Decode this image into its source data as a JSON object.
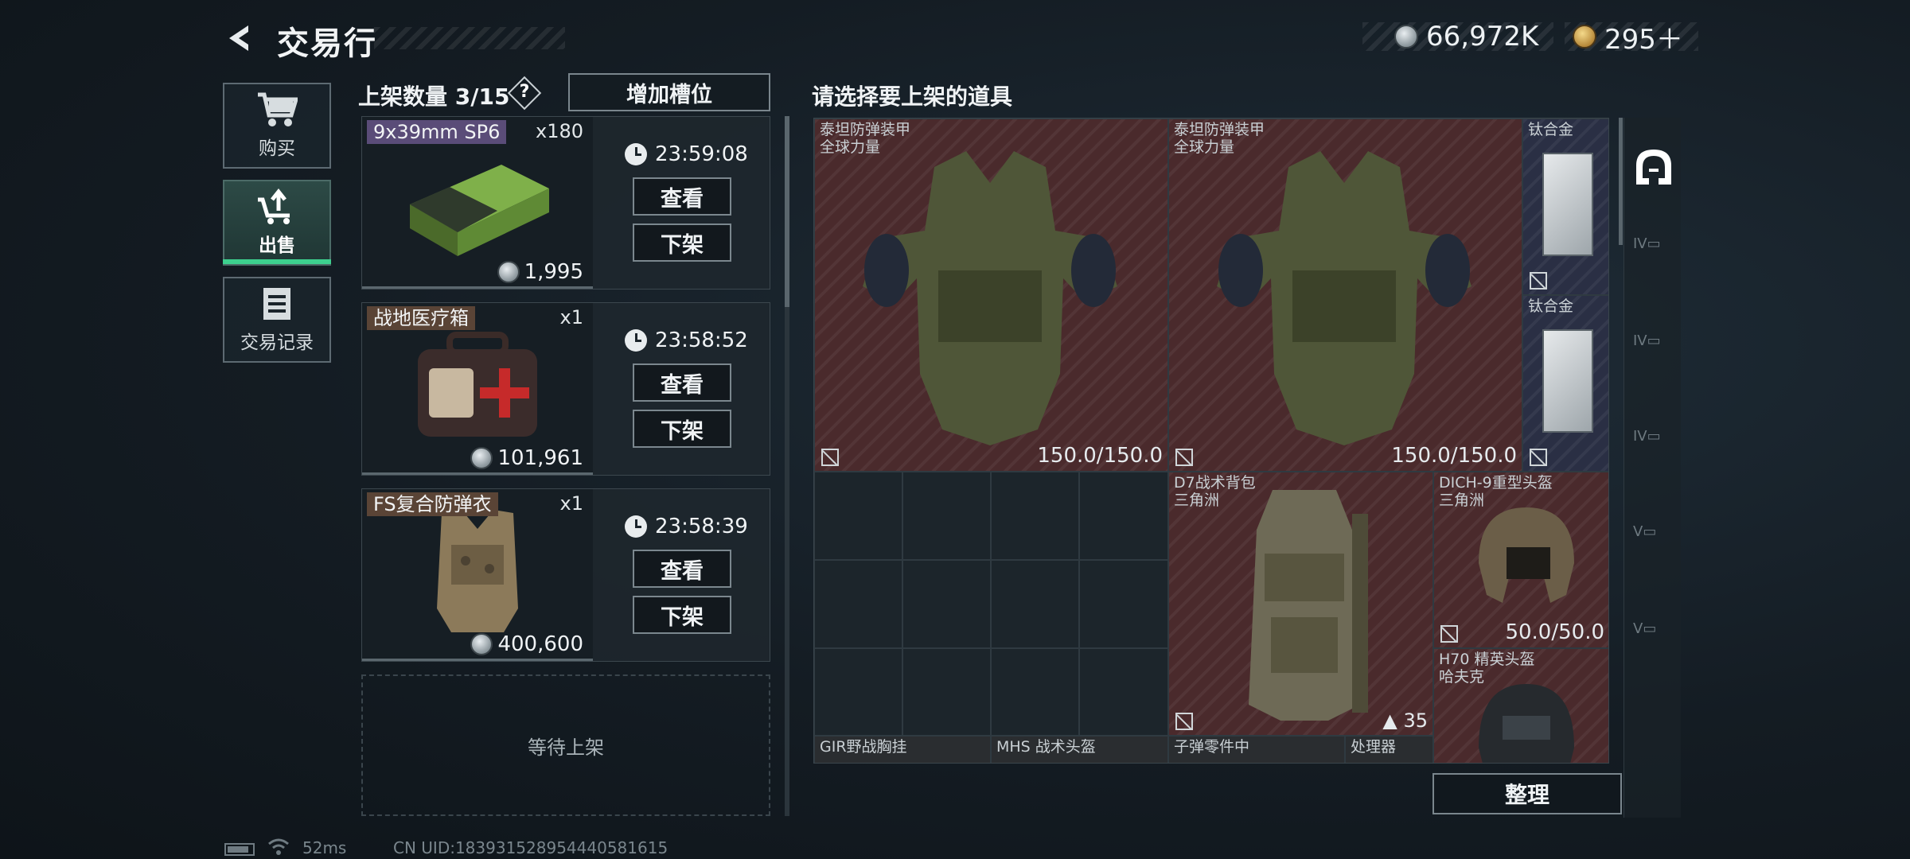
{
  "header": {
    "title": "交易行",
    "currency_silver": "66,972K",
    "currency_gold": "295＋"
  },
  "nav": {
    "buy": "购买",
    "sell": "出售",
    "history": "交易记录"
  },
  "listings": {
    "count_label": "上架数量 3/15",
    "help": "?",
    "add_slot": "增加槽位",
    "items": [
      {
        "name": "9x39mm SP6",
        "qty": "x180",
        "price": "1,995",
        "timer": "23:59:08",
        "view": "查看",
        "delist": "下架"
      },
      {
        "name": "战地医疗箱",
        "qty": "x1",
        "price": "101,961",
        "timer": "23:58:52",
        "view": "查看",
        "delist": "下架"
      },
      {
        "name": "FS复合防弹衣",
        "qty": "x1",
        "price": "400,600",
        "timer": "23:58:39",
        "view": "查看",
        "delist": "下架"
      }
    ],
    "empty_slot": "等待上架"
  },
  "inventory": {
    "title": "请选择要上架的道具",
    "items": [
      {
        "name": "泰坦防弹装甲",
        "sub": "全球力量",
        "durability": "150.0/150.0"
      },
      {
        "name": "泰坦防弹装甲",
        "sub": "全球力量",
        "durability": "150.0/150.0"
      },
      {
        "name": "钛合金",
        "sub": ""
      },
      {
        "name": "钛合金",
        "sub": ""
      },
      {
        "name": "D7战术背包",
        "sub": "三角洲",
        "count": "35"
      },
      {
        "name": "DICH-9重型头盔",
        "sub": "三角洲",
        "durability": "50.0/50.0"
      },
      {
        "name": "H70 精英头盔",
        "sub": "哈夫克"
      },
      {
        "name": "GIR野战胸挂",
        "sub": ""
      },
      {
        "name": "MHS 战术头盔",
        "sub": ""
      },
      {
        "name": "子弹零件中",
        "sub": ""
      },
      {
        "name": "处理器",
        "sub": ""
      }
    ],
    "side_labels": [
      "IV",
      "IV",
      "IV",
      "V",
      "V"
    ],
    "arrange": "整理"
  },
  "footer": {
    "ping": "52ms",
    "uid": "CN UID:183931528954440581615"
  },
  "colors": {
    "accent_green": "#3dd08e",
    "red_rarity": "#4a2a2c",
    "blue_rarity": "#2a2f44"
  }
}
